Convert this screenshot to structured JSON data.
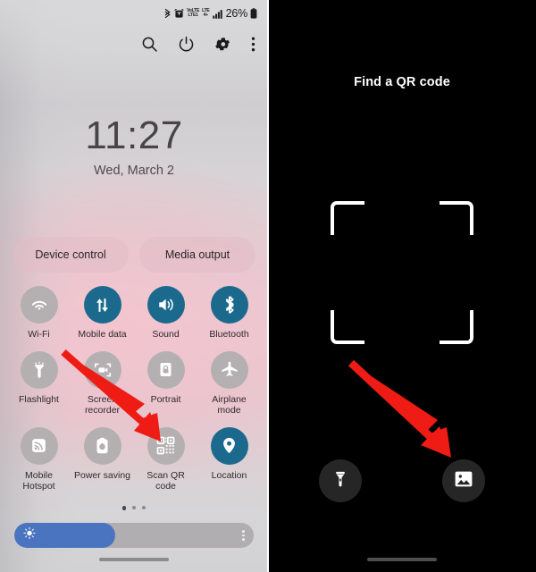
{
  "left_panel": {
    "status_bar": {
      "icons": [
        "bluetooth-icon",
        "alarm-icon",
        "volte-icon",
        "lte-icon",
        "signal-bars-icon"
      ],
      "volte_top": "VoLTE",
      "volte_bottom": "LTE1",
      "lte_top": "LTE",
      "lte_bottom": "4+",
      "battery_percent": "26%"
    },
    "top_actions": [
      {
        "name": "search-icon",
        "label": "Search"
      },
      {
        "name": "power-icon",
        "label": "Power"
      },
      {
        "name": "settings-gear-icon",
        "label": "Settings"
      },
      {
        "name": "overflow-menu-icon",
        "label": "More options"
      }
    ],
    "clock": {
      "time": "11:27",
      "date": "Wed, March 2"
    },
    "pills": [
      {
        "label": "Device control"
      },
      {
        "label": "Media output"
      }
    ],
    "toggles": [
      {
        "label": "Wi-Fi",
        "icon": "wifi-icon",
        "active": false
      },
      {
        "label": "Mobile data",
        "icon": "mobile-data-icon",
        "active": true
      },
      {
        "label": "Sound",
        "icon": "sound-icon",
        "active": true
      },
      {
        "label": "Bluetooth",
        "icon": "bluetooth-icon",
        "active": true
      },
      {
        "label": "Flashlight",
        "icon": "flashlight-icon",
        "active": false
      },
      {
        "label": "Screen recorder",
        "icon": "screen-recorder-icon",
        "active": false
      },
      {
        "label": "Portrait",
        "icon": "portrait-lock-icon",
        "active": false
      },
      {
        "label": "Airplane mode",
        "icon": "airplane-icon",
        "active": false
      },
      {
        "label": "Mobile Hotspot",
        "icon": "hotspot-icon",
        "active": false
      },
      {
        "label": "Power saving",
        "icon": "power-saving-icon",
        "active": false
      },
      {
        "label": "Scan QR code",
        "icon": "qr-code-icon",
        "active": false
      },
      {
        "label": "Location",
        "icon": "location-pin-icon",
        "active": true
      }
    ],
    "page_dots": {
      "count": 3,
      "active_index": 0
    },
    "brightness": {
      "value_percent": 42,
      "icon": "brightness-sun-icon",
      "options_icon": "overflow-menu-icon"
    },
    "home_indicator": "home-gesture-bar"
  },
  "right_panel": {
    "title": "Find a QR code",
    "scanner_frame": "qr-scanner-bracket-frame",
    "actions": [
      {
        "name": "flashlight-button",
        "icon": "flashlight-icon"
      },
      {
        "name": "gallery-button",
        "icon": "image-gallery-icon"
      }
    ],
    "home_indicator": "home-gesture-bar"
  },
  "annotations": {
    "accent_color": "#ee1c14",
    "arrows": [
      {
        "name": "arrow-to-scan-qr-code",
        "target": "Scan QR code"
      },
      {
        "name": "arrow-to-gallery-button",
        "target": "gallery-button"
      }
    ]
  }
}
